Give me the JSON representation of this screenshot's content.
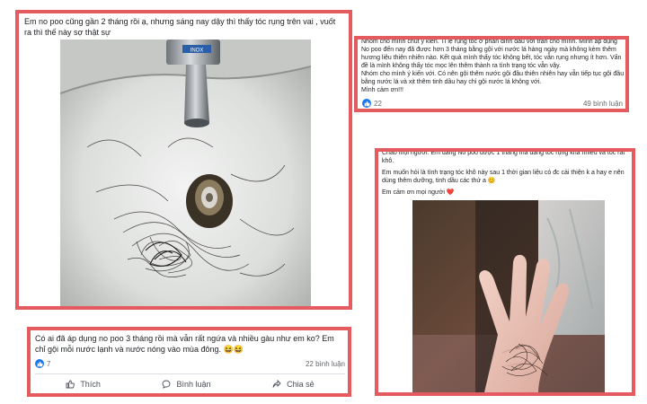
{
  "post1": {
    "text": "Em no poo cũng gần 2 tháng rồi ạ, nhưng sáng nay dậy thì thấy tóc rụng trên vai , vuốt ra thì thế này sợ thật sự",
    "faucet_label": "INOX"
  },
  "post2": {
    "text": "Nhóm cho mình chút ý kiến. Tỉ lệ rụng tóc ở phần đỉnh đầu với trán cho mình. Mình áp dụng No poo đến nay đã được hơn 3 tháng bằng gội với nước lá hàng ngày mà không kèm thêm hương liệu thiên nhiên nào. Kết quả mình thấy tóc không bết, tóc vẫn rụng nhưng ít hơn. Vấn đề là mình không thấy tóc mọc lên thêm thành ra tình trạng tóc vẫn vậy.\nNhóm cho mình ý kiến với. Có nên gội thêm nước gội đầu thiên nhiên hay vẫn tiếp tục gội đầu bằng nước lá và xịt thêm tinh dầu hay chỉ gội nước lá không với.\nMình cảm ơn!!!",
    "likes": "22",
    "comments": "49 bình luận"
  },
  "post3": {
    "text1": "Chào mọi người. Em đang No poo được 1 tháng mà đang tóc rụng khá nhiều và tóc rất khô.",
    "text2": "Em muốn hỏi là tình trạng tóc khô này sau 1 thời gian liệu có đc cải thiện k a hay e nên dùng thêm dưỡng, tinh dầu các thứ a 😊",
    "text3": "Em cảm ơn mọi người ❤️"
  },
  "post4": {
    "text": "Có ai đã áp dụng no poo 3 tháng rồi mà vẫn rất ngứa và nhiều gàu như em ko? Em chỉ gội mỗi nước lạnh và nước nóng vào mùa đông. 😆😆",
    "likes": "7",
    "comments": "22 bình luận",
    "actions": {
      "like": "Thích",
      "comment": "Bình luận",
      "share": "Chia sẻ"
    }
  },
  "colors": {
    "highlight_border": "#e55a5f",
    "like_blue": "#1877f2",
    "text": "#1c1e21",
    "meta": "#65676b"
  },
  "icons": {
    "like": "thumbs-up-icon",
    "comment": "speech-bubble-icon",
    "share": "share-arrow-icon"
  }
}
